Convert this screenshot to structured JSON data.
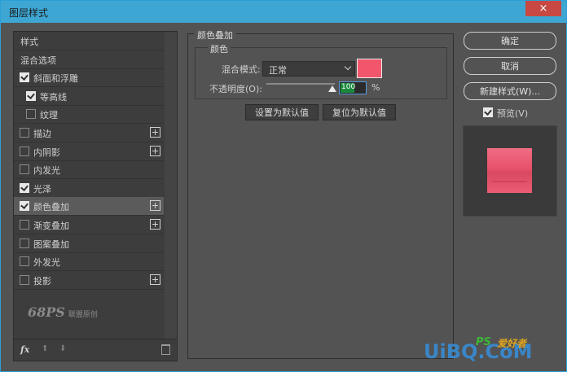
{
  "window": {
    "title": "图层样式",
    "close_icon": "×"
  },
  "sidebar": {
    "items": [
      {
        "label": "样式",
        "checkbox": false,
        "checked": false,
        "plus": false,
        "indent": 0
      },
      {
        "label": "混合选项",
        "checkbox": false,
        "checked": false,
        "plus": false,
        "indent": 0
      },
      {
        "label": "斜面和浮雕",
        "checkbox": true,
        "checked": true,
        "plus": false,
        "indent": 0
      },
      {
        "label": "等高线",
        "checkbox": true,
        "checked": true,
        "plus": false,
        "indent": 1
      },
      {
        "label": "纹理",
        "checkbox": true,
        "checked": false,
        "plus": false,
        "indent": 1
      },
      {
        "label": "描边",
        "checkbox": true,
        "checked": false,
        "plus": true,
        "indent": 0
      },
      {
        "label": "内阴影",
        "checkbox": true,
        "checked": false,
        "plus": true,
        "indent": 0
      },
      {
        "label": "内发光",
        "checkbox": true,
        "checked": false,
        "plus": false,
        "indent": 0
      },
      {
        "label": "光泽",
        "checkbox": true,
        "checked": true,
        "plus": false,
        "indent": 0
      },
      {
        "label": "颜色叠加",
        "checkbox": true,
        "checked": true,
        "plus": true,
        "indent": 0,
        "active": true
      },
      {
        "label": "渐变叠加",
        "checkbox": true,
        "checked": false,
        "plus": true,
        "indent": 0
      },
      {
        "label": "图案叠加",
        "checkbox": true,
        "checked": false,
        "plus": false,
        "indent": 0
      },
      {
        "label": "外发光",
        "checkbox": true,
        "checked": false,
        "plus": false,
        "indent": 0
      },
      {
        "label": "投影",
        "checkbox": true,
        "checked": false,
        "plus": true,
        "indent": 0
      }
    ],
    "bottom": {
      "fx_label": "fx",
      "up_icon": "⬆",
      "down_icon": "⬇",
      "trash_icon": "trash-icon"
    },
    "watermark": {
      "main": "68PS",
      "sub": "联盟原创"
    }
  },
  "color_overlay": {
    "panel_title": "颜色叠加",
    "group_title": "颜色",
    "blend_mode_label": "混合模式:",
    "blend_mode_value": "正常",
    "color": "#f2566c",
    "opacity_label": "不透明度(O):",
    "opacity_value": "100",
    "opacity_unit": "%",
    "opacity_fraction": 1.0,
    "set_default_label": "设置为默认值",
    "reset_default_label": "复位为默认值"
  },
  "actions": {
    "ok_label": "确定",
    "cancel_label": "取消",
    "new_style_label": "新建样式(W)...",
    "preview_label": "预览(V)",
    "preview_checked": true
  },
  "preview": {
    "color": "#e9546d"
  },
  "brand": {
    "site": "UiBQ.CoM",
    "ps": "PS",
    "cn": "爱好者"
  }
}
